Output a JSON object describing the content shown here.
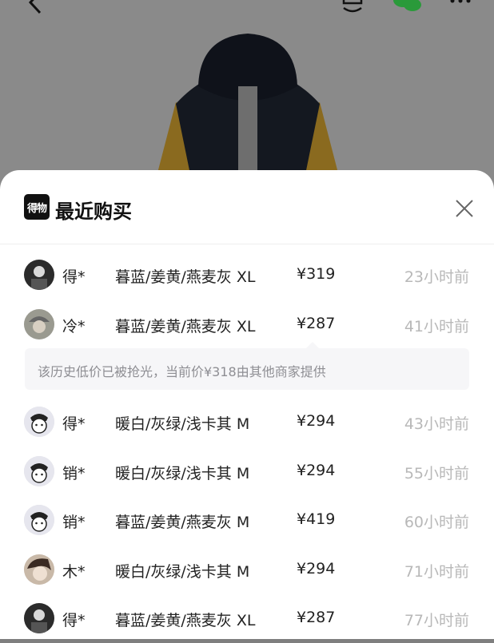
{
  "sheet": {
    "title": "最近购买",
    "brand_logo_text": "得物"
  },
  "notice": {
    "text": "该历史低价已被抢光，当前价¥318由其他商家提供"
  },
  "purchases_top": [
    {
      "buyer": "得*",
      "spec": "暮蓝/姜黄/燕麦灰 XL",
      "price": "¥319",
      "time": "23小时前",
      "avatar": "avatar-dark"
    },
    {
      "buyer": "冷*",
      "spec": "暮蓝/姜黄/燕麦灰 XL",
      "price": "¥287",
      "time": "41小时前",
      "avatar": "avatar-cap"
    }
  ],
  "purchases_bottom": [
    {
      "buyer": "得*",
      "spec": "暖白/灰绿/浅卡其 M",
      "price": "¥294",
      "time": "43小时前",
      "avatar": "avatar-default"
    },
    {
      "buyer": "销*",
      "spec": "暖白/灰绿/浅卡其 M",
      "price": "¥294",
      "time": "55小时前",
      "avatar": "avatar-default"
    },
    {
      "buyer": "销*",
      "spec": "暮蓝/姜黄/燕麦灰 M",
      "price": "¥419",
      "time": "60小时前",
      "avatar": "avatar-default"
    },
    {
      "buyer": "木*",
      "spec": "暖白/灰绿/浅卡其 M",
      "price": "¥294",
      "time": "71小时前",
      "avatar": "avatar-photo"
    },
    {
      "buyer": "得*",
      "spec": "暮蓝/姜黄/燕麦灰 XL",
      "price": "¥287",
      "time": "77小时前",
      "avatar": "avatar-dark"
    }
  ],
  "icons": {
    "back": "back-arrow-icon",
    "sell": "sell-icon",
    "share": "wechat-icon",
    "more": "more-icon",
    "close": "close-icon"
  },
  "colors": {
    "overlay": "#7f7f7f",
    "sheet_bg": "#ffffff",
    "time_text": "#b8b8b8",
    "notice_bg": "#f6f6f8",
    "notice_text": "#8e8e93",
    "jacket_yellow": "#d9a52a",
    "jacket_navy": "#1c2433"
  }
}
